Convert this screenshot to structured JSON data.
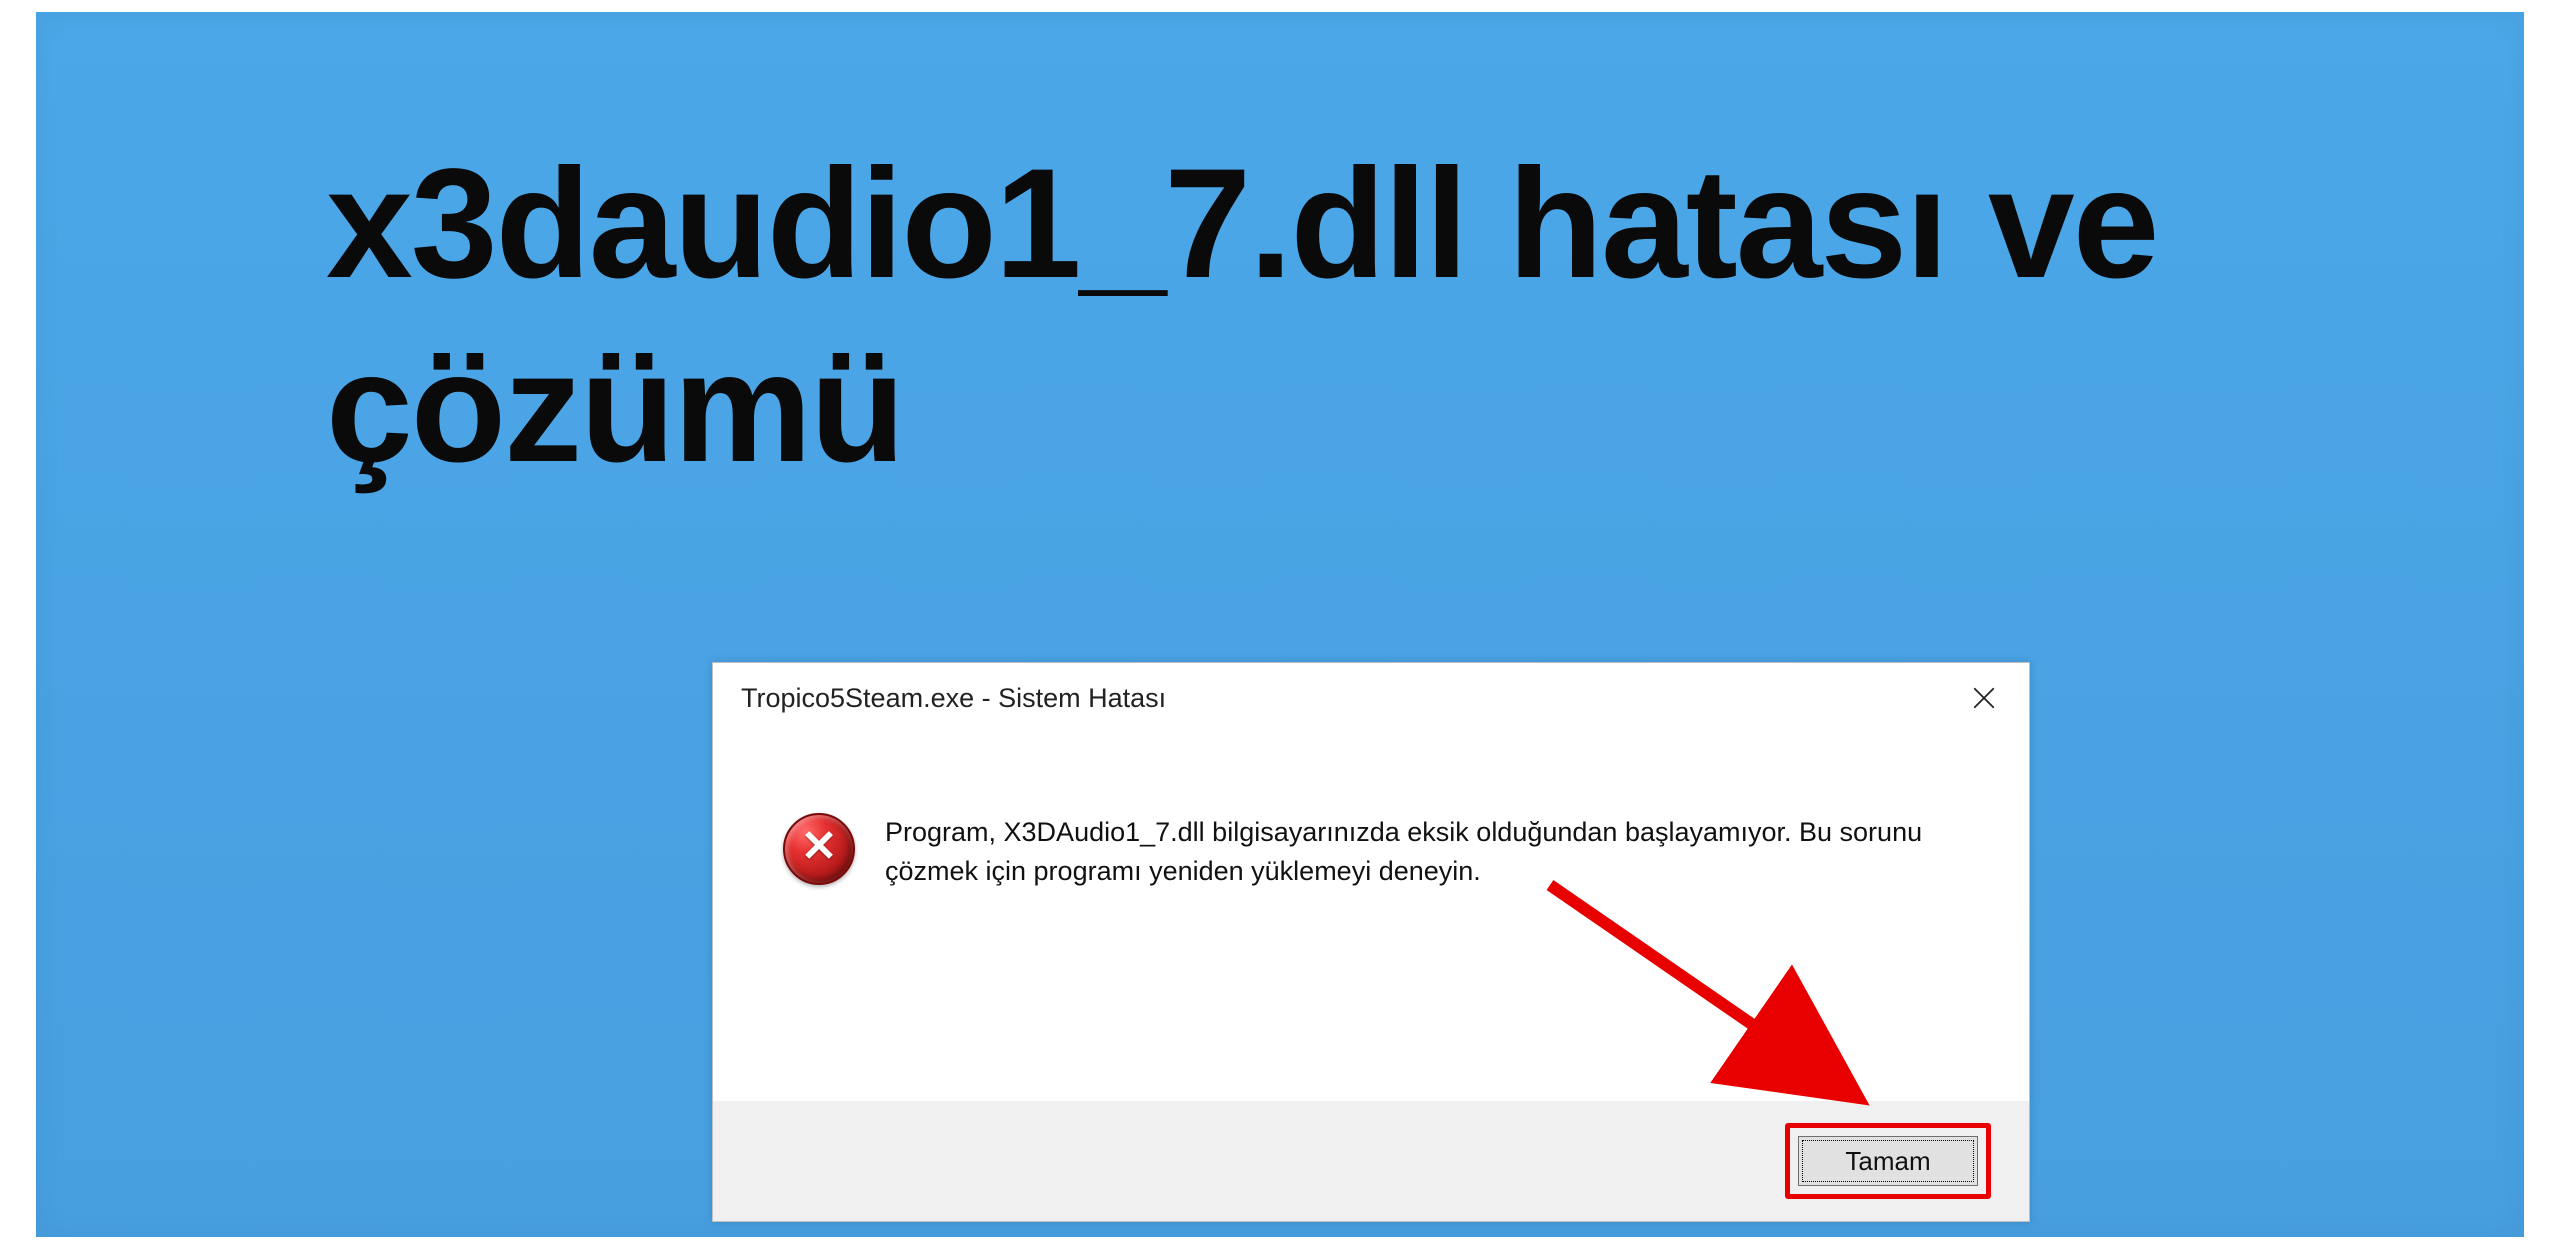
{
  "colors": {
    "background_blue": "#4ba7e8",
    "annotation_red": "#e80000"
  },
  "headline": "x3daudio1_7.dll hatası ve çözümü",
  "dialog": {
    "title": "Tropico5Steam.exe - Sistem Hatası",
    "icon": "error-icon",
    "message": "Program, X3DAudio1_7.dll bilgisayarınızda eksik olduğundan başlayamıyor. Bu sorunu çözmek için programı yeniden yüklemeyi deneyin.",
    "ok_label": "Tamam",
    "close_label": "Close"
  }
}
